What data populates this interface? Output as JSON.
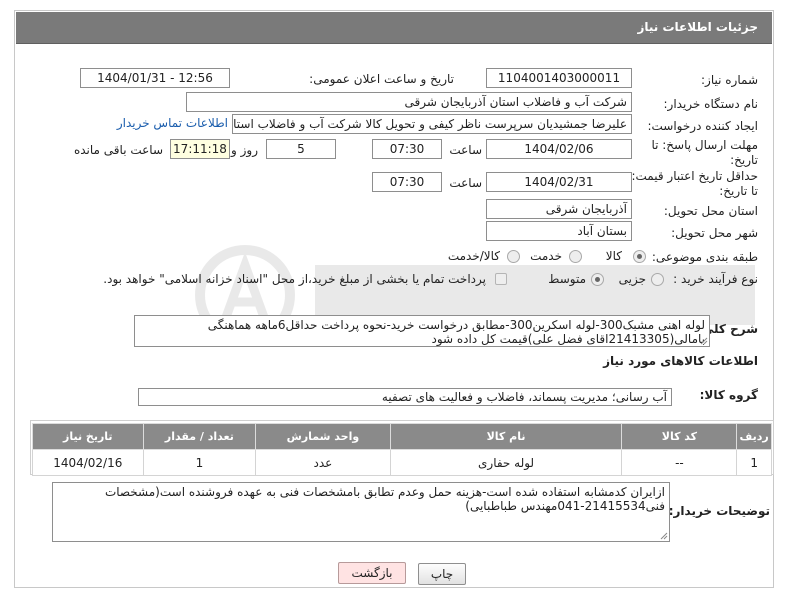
{
  "header": {
    "title": "جزئیات اطلاعات نیاز"
  },
  "labels": {
    "need_number": "شماره نیاز:",
    "public_announce": "تاریخ و ساعت اعلان عمومی:",
    "buyer_org": "نام دستگاه خریدار:",
    "requester": "ایجاد کننده درخواست:",
    "reply_deadline_line1": "مهلت ارسال پاسخ: تا",
    "reply_deadline_line2": "تاریخ:",
    "price_validity_line1": "حداقل تاریخ اعتبار قیمت:",
    "price_validity_line2": "تا تاریخ:",
    "time": "ساعت",
    "days_and": "روز و",
    "hours_remaining": "ساعت باقی مانده",
    "delivery_province": "استان محل تحویل:",
    "delivery_city": "شهر محل تحویل:",
    "category": "طبقه بندی موضوعی:",
    "purchase_process": "نوع فرآیند خرید :",
    "general_desc": "شرح کلی نیاز:",
    "goods_info": "اطلاعات کالاهای مورد نیاز",
    "goods_group": "گروه کالا:",
    "buyer_notes": "توضیحات خریدار:"
  },
  "fields": {
    "need_number": "1104001403000011",
    "public_announce": "1404/01/31 - 12:56",
    "buyer_org": "شرکت آب و فاضلاب استان آذربایجان شرقی",
    "requester": "علیرضا جمشیدیان سرپرست ناظر کیفی و تحویل کالا شرکت آب و فاضلاب استان",
    "contact_link": "اطلاعات تماس خریدار",
    "reply_date": "1404/02/06",
    "reply_time": "07:30",
    "reply_days": "5",
    "reply_remaining": "17:11:18",
    "validity_date": "1404/02/31",
    "validity_time": "07:30",
    "delivery_province": "آذربایجان شرقی",
    "delivery_city": "بستان آباد"
  },
  "category_options": [
    {
      "label": "کالا",
      "selected": true
    },
    {
      "label": "خدمت",
      "selected": false
    },
    {
      "label": "کالا/خدمت",
      "selected": false
    }
  ],
  "process_options": [
    {
      "label": "جزیی",
      "selected": false
    },
    {
      "label": "متوسط",
      "selected": true
    }
  ],
  "payment_note": "پرداخت تمام یا بخشی از مبلغ خرید،از محل \"اسناد خزانه اسلامی\" خواهد بود.",
  "general_desc": {
    "line1": "لوله اهنی مشبک300-لوله اسکرین300-مطابق درخواست خرید-نحوه پرداخت حداقل6ماهه هماهنگی",
    "line2": "بامالی(21413305اقای فضل علی)قیمت کل داده شود"
  },
  "goods_group": "آب رسانی؛ مدیریت پسماند، فاضلاب و فعالیت های تصفیه",
  "table": {
    "headers": [
      "ردیف",
      "کد کالا",
      "نام کالا",
      "واحد شمارش",
      "تعداد / مقدار",
      "تاریخ نیاز"
    ],
    "rows": [
      {
        "row": "1",
        "code": "--",
        "name": "لوله حفاری",
        "unit": "عدد",
        "qty": "1",
        "date": "1404/02/16"
      }
    ]
  },
  "buyer_notes": {
    "line1": "ازایران کدمشابه استفاده شده است-هزینه حمل وعدم تطابق بامشخصات فنی به عهده فروشنده است(مشخصات",
    "line2": "فنی21415534-041مهندس طباطبایی)"
  },
  "buttons": {
    "print": "چاپ",
    "back": "بازگشت"
  },
  "colors": {
    "title_bar": "#7a7a7a",
    "table_header": "#8a8a8a",
    "link": "#1a5dad",
    "back_button": "#ffe3e3"
  }
}
